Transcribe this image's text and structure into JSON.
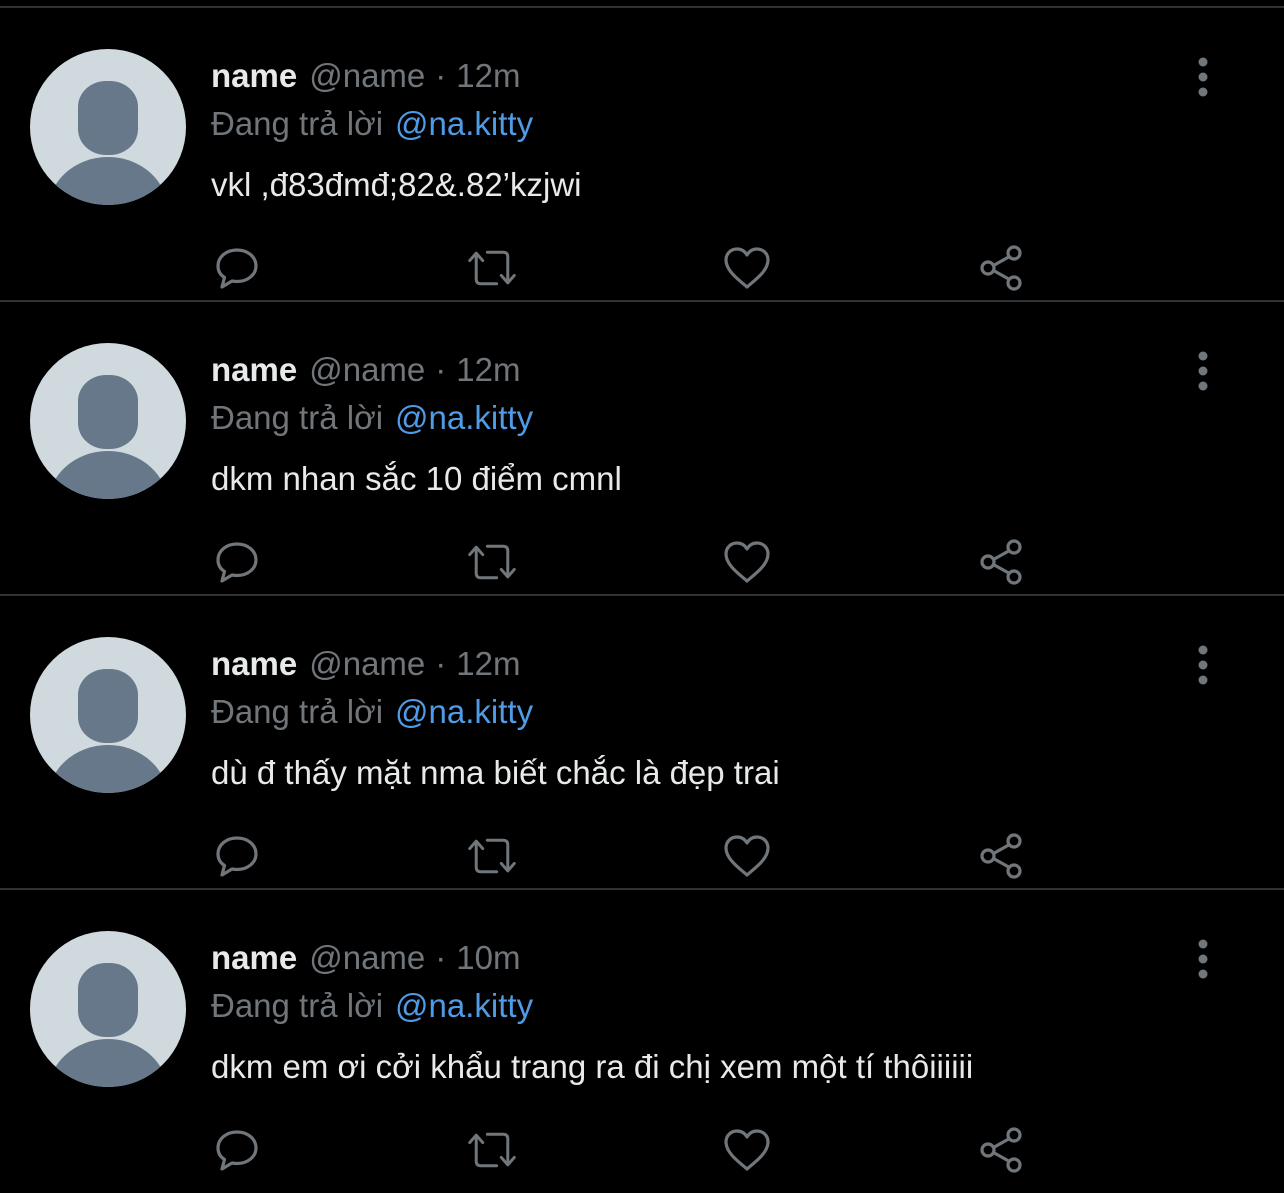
{
  "theme": {
    "background": "#000000",
    "divider": "#2f3336",
    "text_primary": "#e7e9ea",
    "text_secondary": "#71767b",
    "link": "#4f9be5",
    "avatar_bg": "#cfd9de",
    "avatar_fg": "#66788a"
  },
  "icons": {
    "more": "more-vertical-icon",
    "reply": "reply-bubble-icon",
    "retweet": "retweet-icon",
    "like": "heart-icon",
    "share": "share-icon",
    "avatar": "default-avatar-icon"
  },
  "tweets": [
    {
      "display_name": "name",
      "handle": "@name",
      "separator": "·",
      "time": "12m",
      "reply_prefix": "Đang trả lời",
      "reply_to": "@na.kitty",
      "text": "vkl ,đ83đmđ;82&.82’kzjwi"
    },
    {
      "display_name": "name",
      "handle": "@name",
      "separator": "·",
      "time": "12m",
      "reply_prefix": "Đang trả lời",
      "reply_to": "@na.kitty",
      "text": "dkm nhan sắc 10 điểm cmnl"
    },
    {
      "display_name": "name",
      "handle": "@name",
      "separator": "·",
      "time": "12m",
      "reply_prefix": "Đang trả lời",
      "reply_to": "@na.kitty",
      "text": "dù đ thấy mặt nma biết chắc là đẹp trai"
    },
    {
      "display_name": "name",
      "handle": "@name",
      "separator": "·",
      "time": "10m",
      "reply_prefix": "Đang trả lời",
      "reply_to": "@na.kitty",
      "text": "dkm em ơi cởi khẩu trang ra đi chị xem một tí thôiiiiii"
    }
  ]
}
